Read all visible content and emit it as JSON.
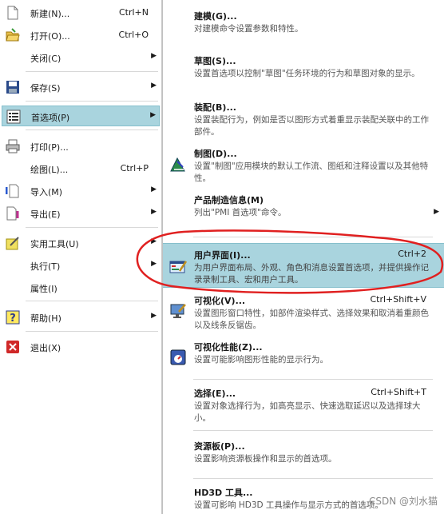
{
  "file_menu": {
    "items": [
      {
        "label": "新建(N)...",
        "shortcut": "Ctrl+N",
        "icon": "new-file-icon"
      },
      {
        "label": "打开(O)...",
        "shortcut": "Ctrl+O",
        "icon": "open-folder-icon"
      },
      {
        "label": "关闭(C)",
        "icon": "none"
      },
      {
        "label": "保存(S)",
        "icon": "save-icon"
      },
      {
        "label": "首选项(P)",
        "icon": "preferences-icon"
      },
      {
        "label": "打印(P)...",
        "icon": "print-icon"
      },
      {
        "label": "绘图(L)...",
        "shortcut": "Ctrl+P",
        "icon": "none"
      },
      {
        "label": "导入(M)",
        "icon": "import-icon"
      },
      {
        "label": "导出(E)",
        "icon": "export-icon"
      },
      {
        "label": "实用工具(U)",
        "icon": "utilities-icon"
      },
      {
        "label": "执行(T)",
        "icon": "none"
      },
      {
        "label": "属性(I)",
        "icon": "none"
      },
      {
        "label": "帮助(H)",
        "icon": "help-icon"
      },
      {
        "label": "退出(X)",
        "icon": "exit-icon"
      }
    ]
  },
  "preferences_submenu": {
    "items": [
      {
        "title": "建模(G)...",
        "desc": "对建模命令设置参数和特性。"
      },
      {
        "title": "草图(S)...",
        "desc": "设置首选项以控制\"草图\"任务环境的行为和草图对象的显示。"
      },
      {
        "title": "装配(B)...",
        "desc": "设置装配行为，例如是否以图形方式着重显示装配关联中的工作部件。"
      },
      {
        "title": "制图(D)...",
        "desc": "设置\"制图\"应用模块的默认工作流、图纸和注释设置以及其他特性。"
      },
      {
        "title": "产品制造信息(M)",
        "desc": "列出\"PMI 首选项\"命令。"
      },
      {
        "title": "用户界面(I)...",
        "shortcut": "Ctrl+2",
        "desc": "为用户界面布局、外观、角色和消息设置首选项，并提供操作记录录制工具、宏和用户工具。"
      },
      {
        "title": "可视化(V)...",
        "shortcut": "Ctrl+Shift+V",
        "desc": "设置图形窗口特性，如部件渲染样式、选择效果和取消着重颜色以及线条反锯齿。"
      },
      {
        "title": "可视化性能(Z)...",
        "desc": "设置可能影响图形性能的显示行为。"
      },
      {
        "title": "选择(E)...",
        "shortcut": "Ctrl+Shift+T",
        "desc": "设置对象选择行为，如高亮显示、快速选取延迟以及选择球大小。"
      },
      {
        "title": "资源板(P)...",
        "desc": "设置影响资源板操作和显示的首选项。"
      },
      {
        "title": "HD3D 工具...",
        "desc": "设置可影响 HD3D 工具操作与显示方式的首选项。"
      }
    ]
  },
  "watermark": "CSDN @刘水猫",
  "colors": {
    "highlight": "#a9d4de",
    "annotation": "#e02020"
  }
}
